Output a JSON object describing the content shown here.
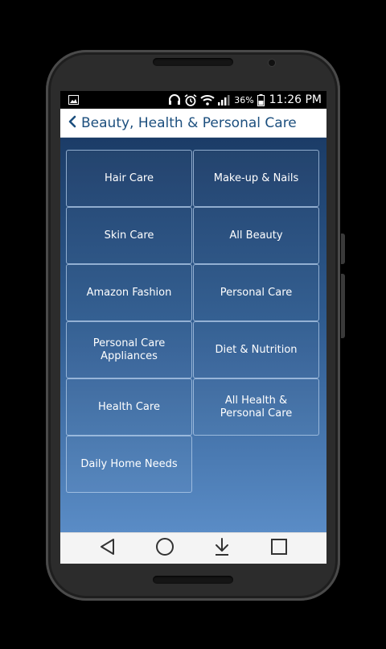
{
  "status_bar": {
    "battery_percent": "36%",
    "time": "11:26 PM",
    "icons": [
      "image-icon",
      "headset-icon",
      "alarm-icon",
      "wifi-icon",
      "signal-icon",
      "battery-icon"
    ]
  },
  "app_bar": {
    "title": "Beauty, Health & Personal Care"
  },
  "categories": [
    {
      "label": "Hair Care"
    },
    {
      "label": "Make-up & Nails"
    },
    {
      "label": "Skin Care"
    },
    {
      "label": "All Beauty"
    },
    {
      "label": "Amazon Fashion"
    },
    {
      "label": "Personal Care"
    },
    {
      "label": "Personal Care Appliances"
    },
    {
      "label": "Diet & Nutrition"
    },
    {
      "label": "Health Care"
    },
    {
      "label": "All Health & Personal Care"
    },
    {
      "label": "Daily Home Needs"
    }
  ],
  "nav_bar": {
    "buttons": [
      "back-icon",
      "home-icon",
      "download-icon",
      "recents-icon"
    ]
  },
  "colors": {
    "title": "#1c4f7e",
    "content_gradient_top": "#1b3c67",
    "content_gradient_bottom": "#5a8cc6"
  }
}
